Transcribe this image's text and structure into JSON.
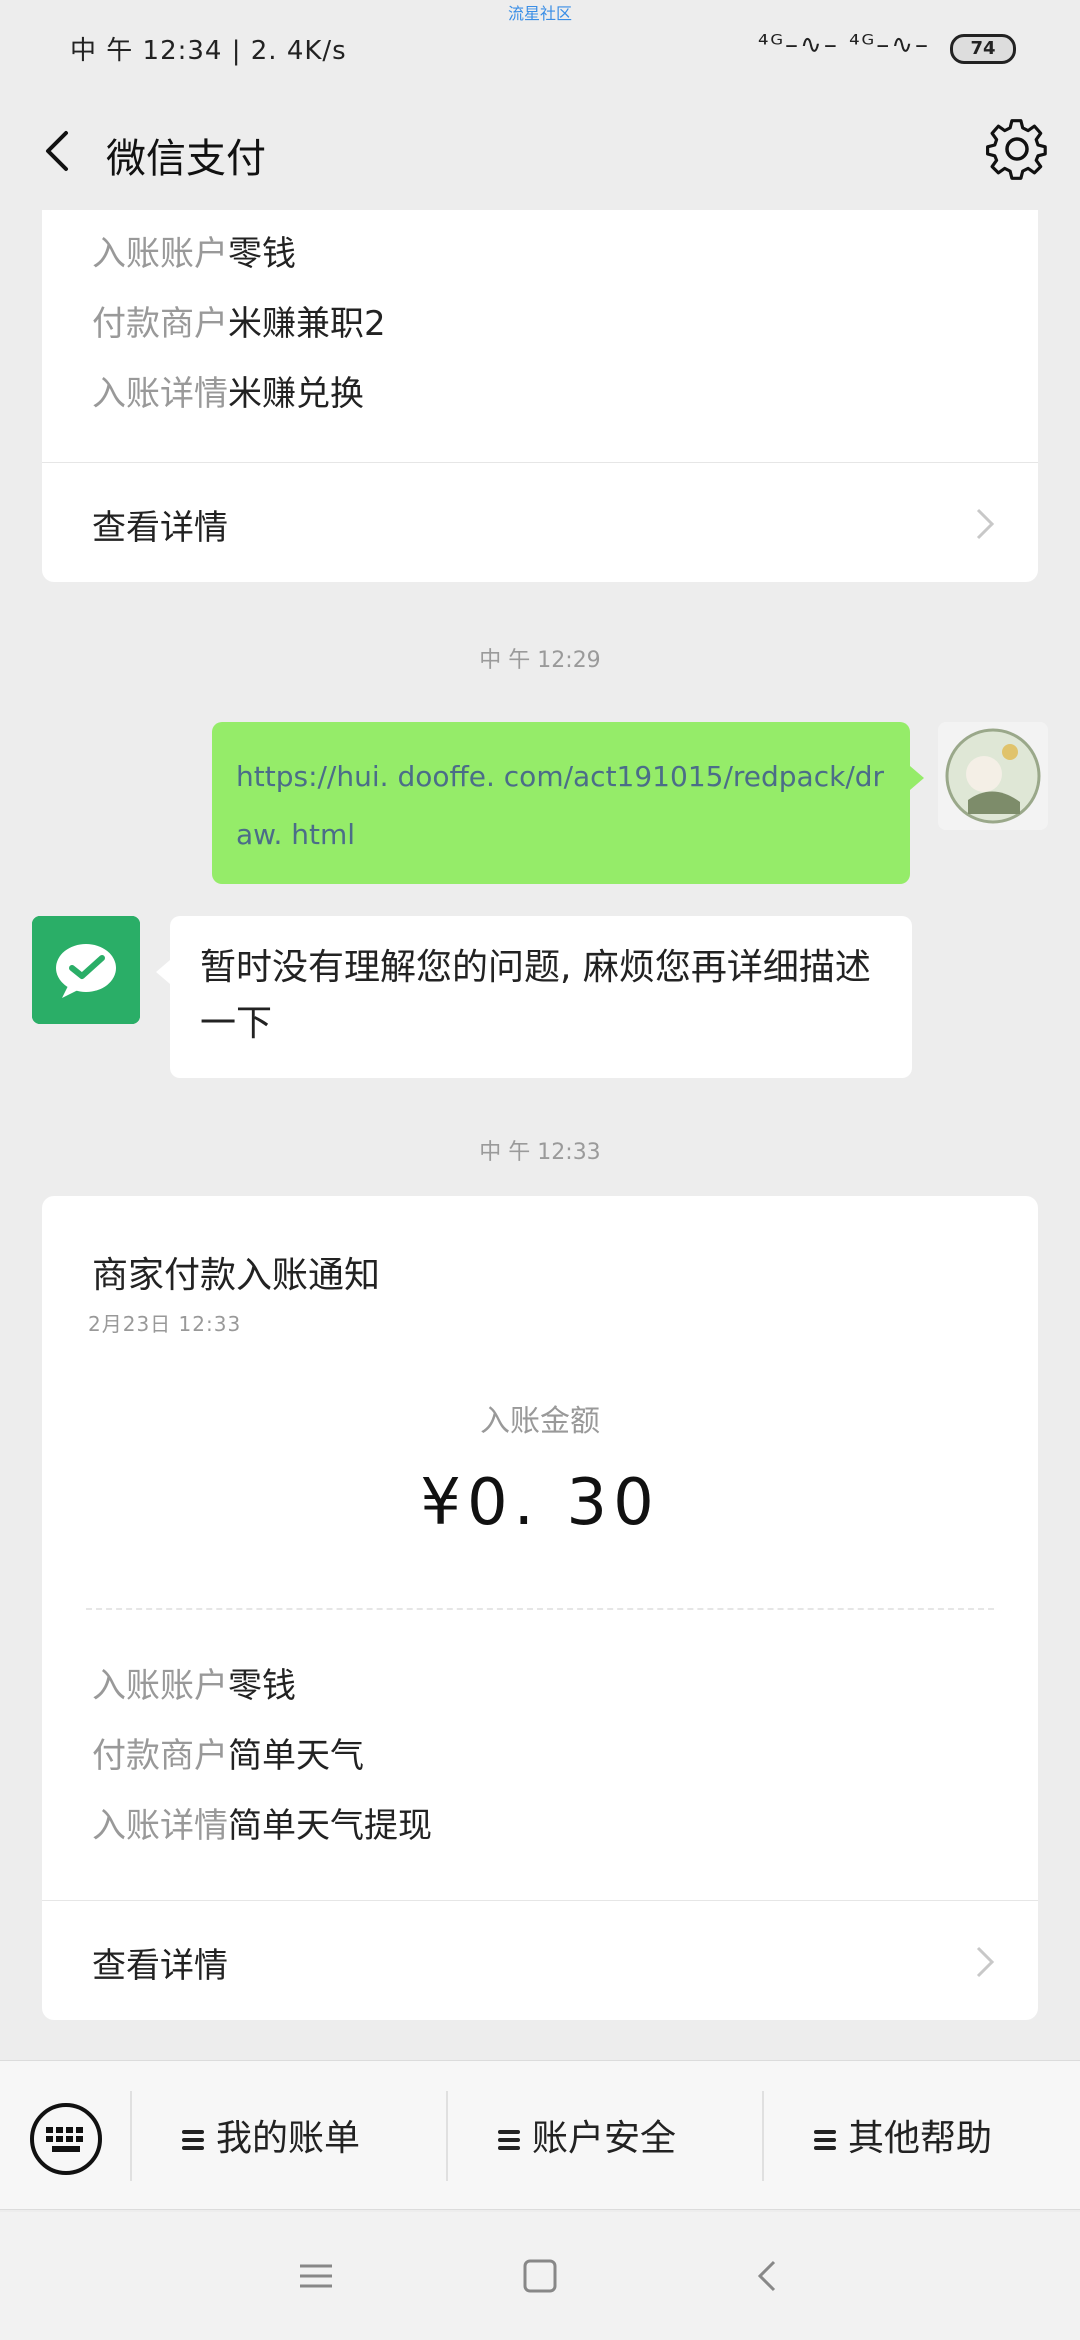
{
  "status_bar": {
    "time": "中 午 12:34 | 2. 4K/s",
    "carrier_label": "流星社区",
    "signals": "⁴ᴳ–∿–  ⁴ᴳ–∿–",
    "battery": "74"
  },
  "navbar": {
    "title": "微信支付"
  },
  "card_top": {
    "rows": [
      {
        "key": "入账账户",
        "value": "零钱"
      },
      {
        "key": "付款商户",
        "value": "米赚兼职2"
      },
      {
        "key": "入账详情",
        "value": "米赚兑换"
      }
    ],
    "detail_label": "查看详情"
  },
  "chat": {
    "timestamp_1": "中 午 12:29",
    "user_message": "https://hui. dooffe. com/act191015/redpack/draw. html",
    "bot_message": "暂时没有理解您的问题, 麻烦您再详细描述一下",
    "timestamp_2": "中 午 12:33"
  },
  "card_notice": {
    "title": "商家付款入账通知",
    "date": "2月23日  12:33",
    "amount_label": "入账金额",
    "amount": "¥0. 30",
    "rows": [
      {
        "key": "入账账户",
        "value": "零钱"
      },
      {
        "key": "付款商户",
        "value": "简单天气"
      },
      {
        "key": "入账详情",
        "value": "简单天气提现"
      }
    ],
    "detail_label": "查看详情"
  },
  "menu": {
    "items": [
      {
        "label": "我的账单"
      },
      {
        "label": "账户安全"
      },
      {
        "label": "其他帮助"
      }
    ]
  },
  "icons": {
    "back": "back-arrow-icon",
    "settings": "gear-icon",
    "keyboard": "keyboard-icon",
    "pay_logo": "wechat-pay-logo-icon"
  },
  "colors": {
    "background": "#ededed",
    "bubble_out": "#95ec69",
    "wechat_green": "#2aae67"
  }
}
